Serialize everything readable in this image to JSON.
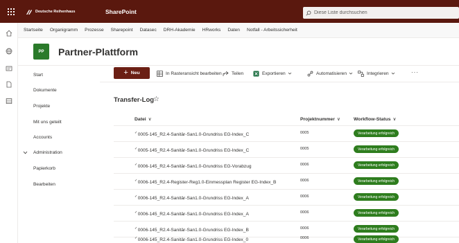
{
  "suite": {
    "org_name": "Deutsche Reihenhaus",
    "app_name": "SharePoint",
    "search_placeholder": "Diese Liste durchsuchen",
    "waffle_icon": "app-launcher-icon",
    "color": "#5a180e"
  },
  "hub_nav": {
    "items": [
      "Startseite",
      "Organigramm",
      "Prozesse",
      "Sharepoint",
      "Datasec",
      "DRH-Akademie",
      "HRworks",
      "Daten",
      "Notfall - Arbeitssicherheit"
    ]
  },
  "site": {
    "logo_text": "PP",
    "title": "Partner-Plattform",
    "logo_color": "#2a7a2a"
  },
  "left_nav": {
    "items": [
      "Start",
      "Dokumente",
      "Projekte",
      "Mit uns geteilt",
      "Accounts",
      "Administration",
      "Papierkorb",
      "Bearbeiten"
    ]
  },
  "command_bar": {
    "new_label": "Neu",
    "grid_edit_label": "In Rasteransicht bearbeiten",
    "share_label": "Teilen",
    "export_label": "Exportieren",
    "automate_label": "Automatisieren",
    "integrate_label": "Integrieren",
    "more_label": "···",
    "new_button_color": "#6b1f14"
  },
  "list": {
    "title": "Transfer-Log",
    "favorite_icon": "star-icon",
    "columns": [
      "Datei",
      "Projektnummer",
      "Workflow-Status"
    ],
    "rows": [
      {
        "file": "0005-145_R2.4-Sanitär-San1.0-Grundriss EG-Index_C",
        "project": "0005",
        "status": "Verarbeitung erfolgreich"
      },
      {
        "file": "0005-145_R2.4-Sanitär-San1.0-Grundriss EG-Index_C",
        "project": "0005",
        "status": "Verarbeitung erfolgreich"
      },
      {
        "file": "0006-145_R2.4-Sanitär-San1.0-Grundriss EG-Vorabzug",
        "project": "0006",
        "status": "Verarbeitung erfolgreich"
      },
      {
        "file": "0006-145_R2.4-Register-Reg1.0-Einmessplan Register EG-Index_B",
        "project": "0006",
        "status": "Verarbeitung erfolgreich"
      },
      {
        "file": "0006-145_R2.4-Sanitär-San1.0-Grundriss EG-Index_A",
        "project": "0006",
        "status": "Verarbeitung erfolgreich"
      },
      {
        "file": "0006-145_R2.4-Sanitär-San1.0-Grundriss EG-Index_A",
        "project": "0006",
        "status": "Verarbeitung erfolgreich"
      },
      {
        "file": "0006-145_R2.4-Sanitär-San1.0-Grundriss EG-Index_B",
        "project": "0006",
        "status": "Verarbeitung erfolgreich"
      },
      {
        "file": "0006-145_R2.4-Sanitär-San1.0-Grundriss EG-Index_0",
        "project": "0006",
        "status": "Verarbeitung erfolgreich"
      }
    ],
    "status_color": "#2e7d1e"
  }
}
